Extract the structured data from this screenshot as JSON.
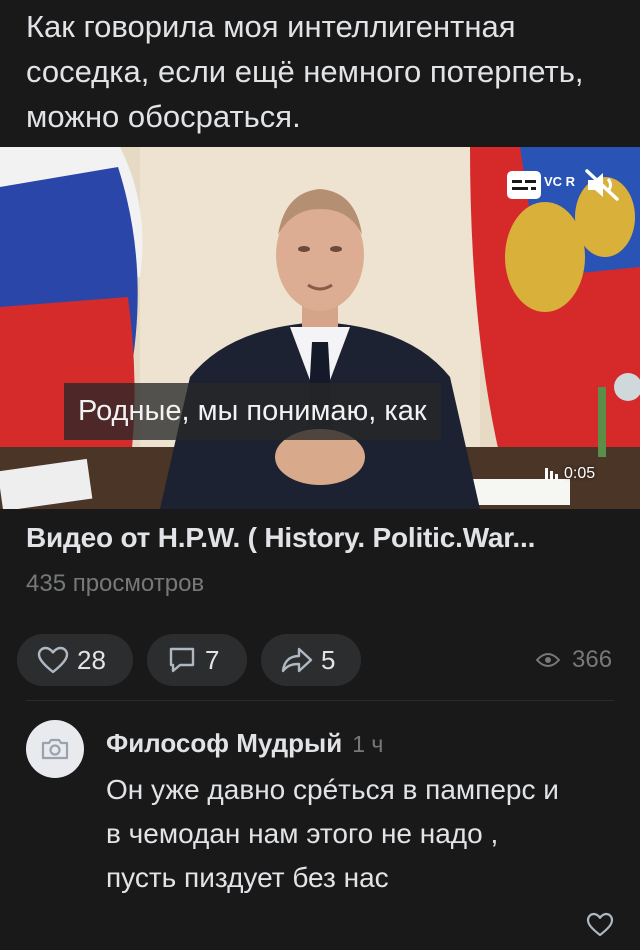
{
  "post": {
    "text": "Как говорила моя интеллигентная соседка, если ещё немного потерпеть, можно обосраться."
  },
  "video": {
    "subtitle": "Родные, мы понимаю, как",
    "duration": "0:05",
    "corner_label": "VC R",
    "title": "Видео от H.P.W. ( History. Politic.War...",
    "views": "435 просмотров"
  },
  "actions": {
    "likes": "28",
    "comments": "7",
    "shares": "5",
    "views": "366"
  },
  "comment": {
    "author": "Философ Мудрый",
    "time": "1 ч",
    "text": "Он уже давно срéться в памперс и в чемодан нам этого не надо , пусть пиздует без нас"
  },
  "colors": {
    "background": "#191919",
    "pill": "#2c2d2e",
    "secondary_text": "#76787a"
  }
}
